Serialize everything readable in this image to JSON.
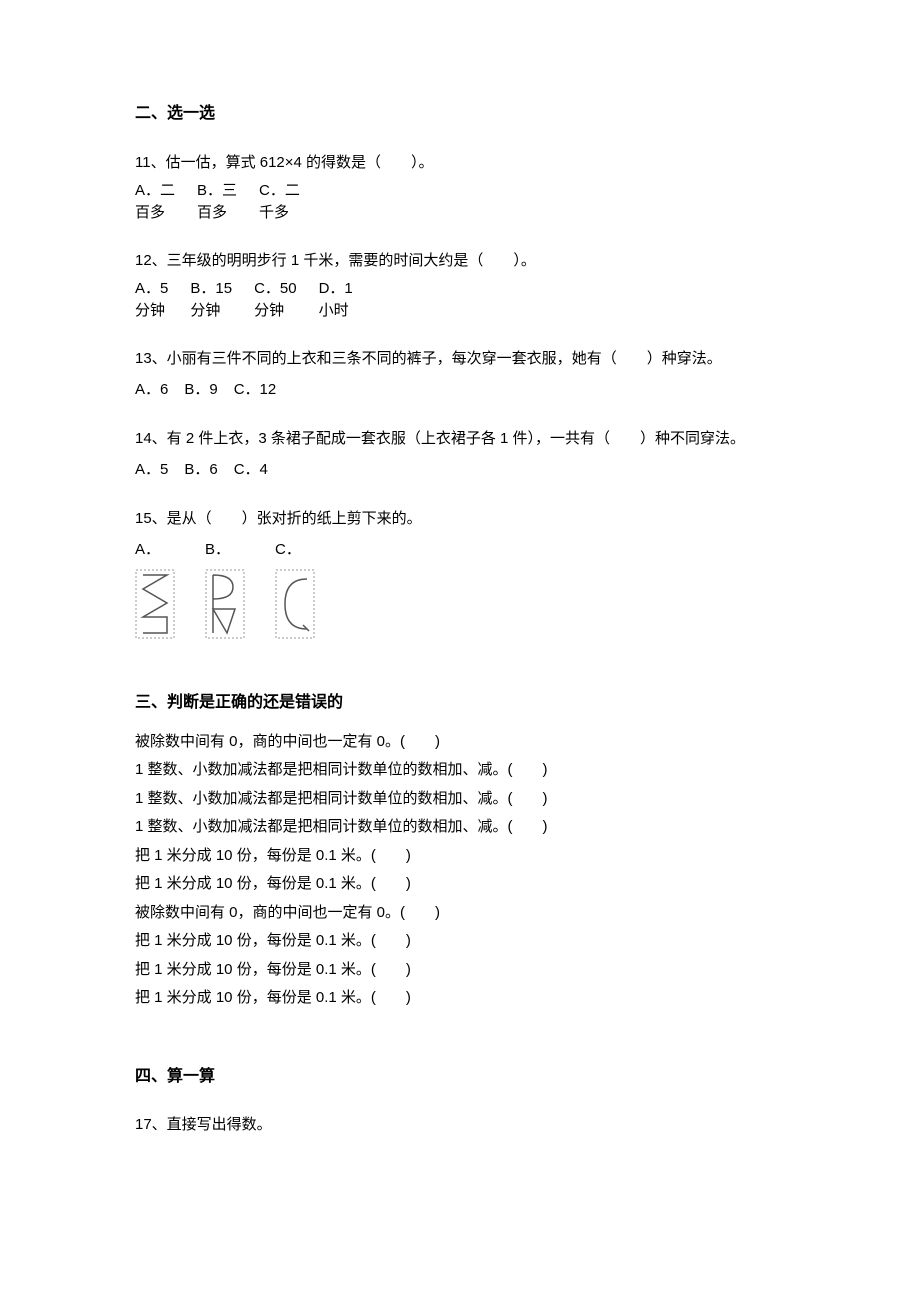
{
  "section2": {
    "heading": "二、选一选",
    "q11": {
      "text": "11、估一估，算式 612×4 的得数是（　　）。",
      "opts": [
        {
          "label": "A．二",
          "sub": "百多"
        },
        {
          "label": "B．三",
          "sub": "百多"
        },
        {
          "label": "C．二",
          "sub": "千多"
        }
      ]
    },
    "q12": {
      "text": "12、三年级的明明步行 1 千米，需要的时间大约是（　　）。",
      "opts": [
        {
          "label": "A．5",
          "sub": "分钟"
        },
        {
          "label": "B．15",
          "sub": "分钟"
        },
        {
          "label": "C．50",
          "sub": "分钟"
        },
        {
          "label": "D．1",
          "sub": "小时"
        }
      ]
    },
    "q13": {
      "text": "13、小丽有三件不同的上衣和三条不同的裤子，每次穿一套衣服，她有（　　）种穿法。",
      "opts": [
        "A．6",
        "B．9",
        "C．12"
      ]
    },
    "q14": {
      "text": "14、有 2 件上衣，3 条裙子配成一套衣服（上衣裙子各 1 件），一共有（　　）种不同穿法。",
      "opts": [
        "A．5",
        "B．6",
        "C．4"
      ]
    },
    "q15": {
      "text": "15、是从（　　）张对折的纸上剪下来的。",
      "opts": [
        "A．",
        "B．",
        "C．"
      ]
    }
  },
  "section3": {
    "heading": "三、判断是正确的还是错误的",
    "items": [
      "被除数中间有 0，商的中间也一定有 0。(　　)",
      "1 整数、小数加减法都是把相同计数单位的数相加、减。(　　)",
      "1 整数、小数加减法都是把相同计数单位的数相加、减。(　　)",
      "1 整数、小数加减法都是把相同计数单位的数相加、减。(　　)",
      "把 1 米分成 10 份，每份是 0.1 米。(　　)",
      "把 1 米分成 10 份，每份是 0.1 米。(　　)",
      "被除数中间有 0，商的中间也一定有 0。(　　)",
      "把 1 米分成 10 份，每份是 0.1 米。(　　)",
      "把 1 米分成 10 份，每份是 0.1 米。(　　)",
      "把 1 米分成 10 份，每份是 0.1 米。(　　)"
    ]
  },
  "section4": {
    "heading": "四、算一算",
    "q17": "17、直接写出得数。"
  }
}
